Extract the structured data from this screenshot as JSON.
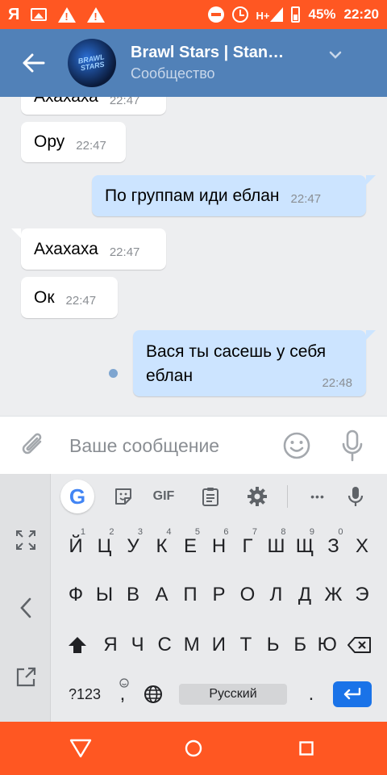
{
  "status_bar": {
    "left_icons": [
      "yandex-icon",
      "image-icon",
      "warning-icon",
      "warning-icon"
    ],
    "yandex_glyph": "Я",
    "network": "H+",
    "battery": "45%",
    "time": "22:20"
  },
  "header": {
    "title": "Brawl Stars | Stan…",
    "subtitle": "Сообщество",
    "avatar_text": "BRAWL STARS"
  },
  "messages": [
    {
      "direction": "in",
      "text": "Ахахаха",
      "time": "22:47"
    },
    {
      "direction": "in",
      "text": "Ору",
      "time": "22:47"
    },
    {
      "direction": "out",
      "text": "По группам иди еблан",
      "time": "22:47"
    },
    {
      "direction": "in",
      "text": "Ахахаха",
      "time": "22:47"
    },
    {
      "direction": "in",
      "text": "Ок",
      "time": "22:47"
    },
    {
      "direction": "out",
      "text": "Вася ты сасешь у себя еблан",
      "time": "22:48",
      "unread": true
    }
  ],
  "compose": {
    "placeholder": "Ваше сообщение"
  },
  "keyboard": {
    "toolbar": [
      "google-icon",
      "sticker-icon",
      "gif-icon",
      "clipboard-icon",
      "settings-icon",
      "more-icon",
      "mic-icon"
    ],
    "google_glyph": "G",
    "gif_label": "GIF",
    "more_glyph": "•••",
    "row1": [
      {
        "k": "Й",
        "n": "1"
      },
      {
        "k": "Ц",
        "n": "2"
      },
      {
        "k": "У",
        "n": "3"
      },
      {
        "k": "К",
        "n": "4"
      },
      {
        "k": "Е",
        "n": "5"
      },
      {
        "k": "Н",
        "n": "6"
      },
      {
        "k": "Г",
        "n": "7"
      },
      {
        "k": "Ш",
        "n": "8"
      },
      {
        "k": "Щ",
        "n": "9"
      },
      {
        "k": "З",
        "n": "0"
      },
      {
        "k": "Х",
        "n": ""
      }
    ],
    "row2": [
      "Ф",
      "Ы",
      "В",
      "А",
      "П",
      "Р",
      "О",
      "Л",
      "Д",
      "Ж",
      "Э"
    ],
    "row3": [
      "Я",
      "Ч",
      "С",
      "М",
      "И",
      "Т",
      "Ь",
      "Б",
      "Ю"
    ],
    "numbers_key": "?123",
    "comma_key": ",",
    "space_label": "Русский",
    "period_key": "."
  },
  "colors": {
    "status_bar": "#ff5722",
    "header": "#5181b8",
    "outgoing_bubble": "#cce4ff",
    "incoming_bubble": "#ffffff",
    "enter_key": "#1a73e8"
  }
}
